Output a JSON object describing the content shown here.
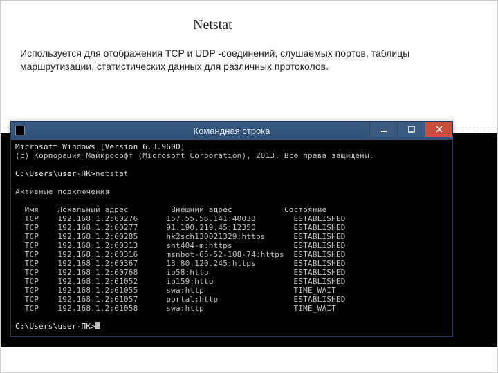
{
  "slide": {
    "title": "Netstat",
    "description": "Используется для отображения TCP и UDP -соединений, слушаемых портов, таблицы маршрутизации, статистических данных для различных протоколов."
  },
  "window": {
    "title": "Командная строка",
    "icon_name": "cmd-icon"
  },
  "terminal": {
    "line1": "Microsoft Windows [Version 6.3.9600]",
    "line2": "(c) Корпорация Майкрософт (Microsoft Corporation), 2013. Все права защищены.",
    "prompt1": "C:\\Users\\user-ПК>",
    "command": "netstat",
    "active_header": "Активные подключения",
    "columns": {
      "proto": "Имя",
      "local": "Локальный адрес",
      "remote": "Внешний адрес",
      "state": "Состояние"
    },
    "rows": [
      {
        "proto": "TCP",
        "local": "192.168.1.2:60276",
        "remote": "157.55.56.141:40033",
        "state": "ESTABLISHED"
      },
      {
        "proto": "TCP",
        "local": "192.168.1.2:60277",
        "remote": "91.190.219.45:12350",
        "state": "ESTABLISHED"
      },
      {
        "proto": "TCP",
        "local": "192.168.1.2:60285",
        "remote": "hk2sch130021329:https",
        "state": "ESTABLISHED"
      },
      {
        "proto": "TCP",
        "local": "192.168.1.2:60313",
        "remote": "snt404-m:https",
        "state": "ESTABLISHED"
      },
      {
        "proto": "TCP",
        "local": "192.168.1.2:60316",
        "remote": "msnbot-65-52-108-74:https",
        "state": "ESTABLISHED"
      },
      {
        "proto": "TCP",
        "local": "192.168.1.2:60367",
        "remote": "13.80.120.245:https",
        "state": "ESTABLISHED"
      },
      {
        "proto": "TCP",
        "local": "192.168.1.2:60768",
        "remote": "ip58:http",
        "state": "ESTABLISHED"
      },
      {
        "proto": "TCP",
        "local": "192.168.1.2:61052",
        "remote": "ip159:http",
        "state": "ESTABLISHED"
      },
      {
        "proto": "TCP",
        "local": "192.168.1.2:61055",
        "remote": "swa:http",
        "state": "TIME_WAIT"
      },
      {
        "proto": "TCP",
        "local": "192.168.1.2:61057",
        "remote": "portal:http",
        "state": "ESTABLISHED"
      },
      {
        "proto": "TCP",
        "local": "192.168.1.2:61058",
        "remote": "swa:http",
        "state": "TIME_WAIT"
      }
    ],
    "prompt2": "C:\\Users\\user-ПК>"
  },
  "colors": {
    "titlebar": "#305078",
    "close": "#c94f3d",
    "term_fg": "#c0c0c0"
  }
}
